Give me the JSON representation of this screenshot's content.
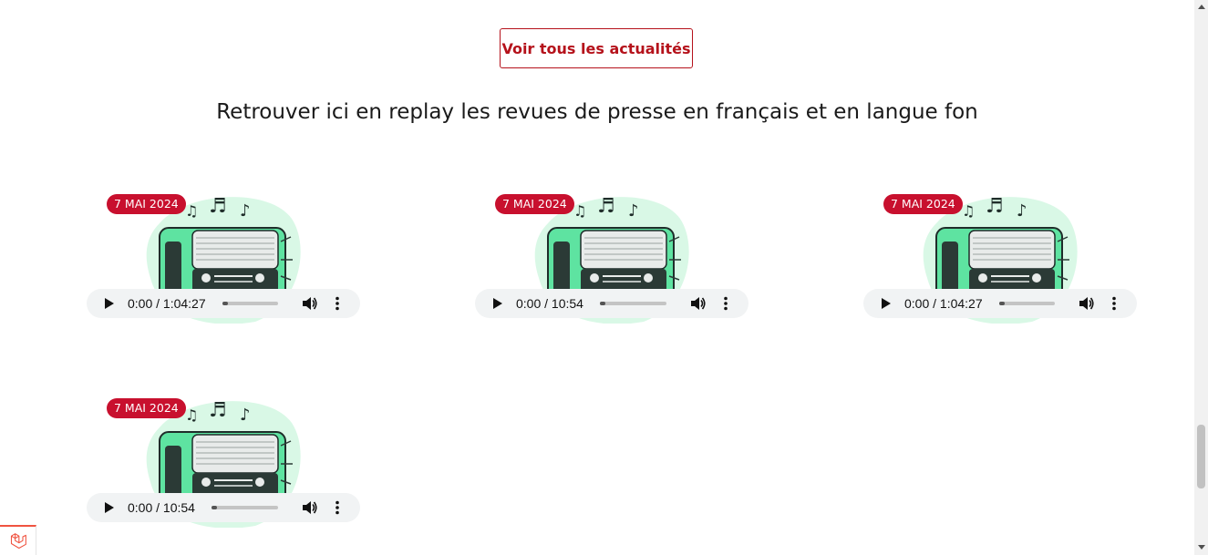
{
  "actions": {
    "see_all_label": "Voir tous les actualités"
  },
  "section": {
    "heading": "Retrouver ici en replay les revues de presse en français et en langue fon"
  },
  "colors": {
    "accent": "#c8102e",
    "radio_green": "#5ee3a1",
    "blob_green": "#d9f8e6"
  },
  "episodes": [
    {
      "date": "7 MAI 2024",
      "time": "0:00 / 1:04:27",
      "progress": 0.0
    },
    {
      "date": "7 MAI 2024",
      "time": "0:00 / 10:54",
      "progress": 0.0
    },
    {
      "date": "7 MAI 2024",
      "time": "0:00 / 1:04:27",
      "progress": 0.0
    },
    {
      "date": "7 MAI 2024",
      "time": "0:00 / 10:54",
      "progress": 0.0
    }
  ],
  "icons": {
    "play": "play-icon",
    "volume": "volume-icon",
    "more": "more-options-icon",
    "laravel": "laravel-logo-icon"
  }
}
